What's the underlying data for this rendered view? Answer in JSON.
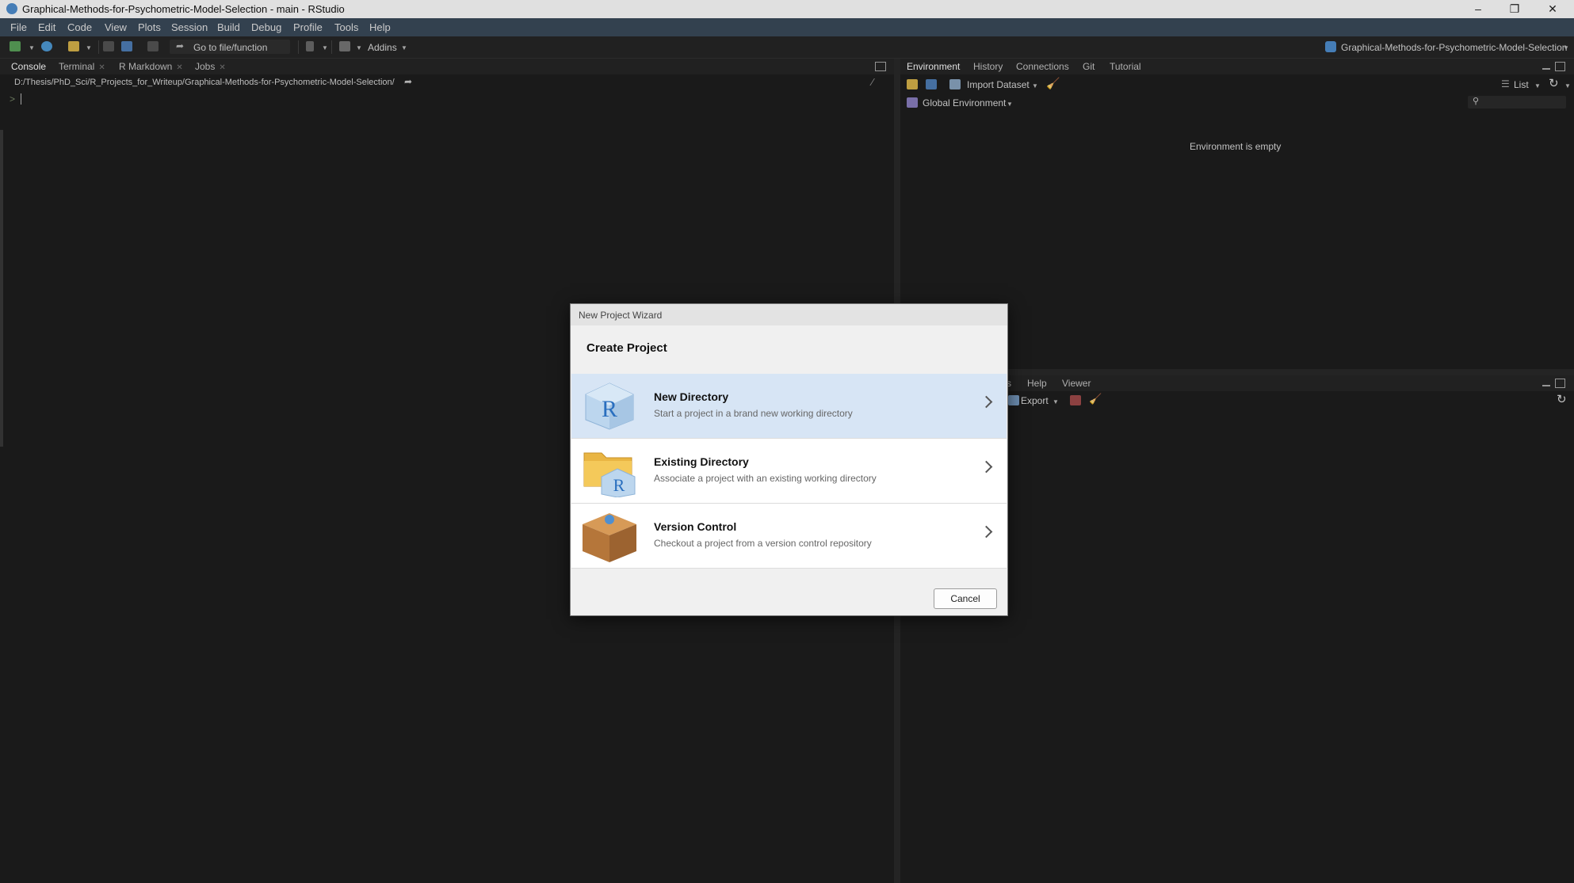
{
  "window": {
    "title": "Graphical-Methods-for-Psychometric-Model-Selection - main - RStudio",
    "controls": [
      "–",
      "❐",
      "✕"
    ]
  },
  "menu": [
    "File",
    "Edit",
    "Code",
    "View",
    "Plots",
    "Session",
    "Build",
    "Debug",
    "Profile",
    "Tools",
    "Help"
  ],
  "toolbar": {
    "goto_label": "Go to file/function",
    "addins_label": "Addins",
    "project_label": "Graphical-Methods-for-Psychometric-Model-Selection"
  },
  "console_pane": {
    "tabs": [
      "Console",
      "Terminal",
      "R Markdown",
      "Jobs"
    ],
    "path": "D:/Thesis/PhD_Sci/R_Projects_for_Writeup/Graphical-Methods-for-Psychometric-Model-Selection/",
    "prompt": ">"
  },
  "env_pane": {
    "tabs": [
      "Environment",
      "History",
      "Connections",
      "Git",
      "Tutorial"
    ],
    "import_label": "Import Dataset",
    "list_label": "List",
    "scope_label": "Global Environment",
    "empty_message": "Environment is empty"
  },
  "lower_pane": {
    "tabs": [
      "s",
      "Help",
      "Viewer"
    ],
    "export_label": "Export"
  },
  "dialog": {
    "window_title": "New Project Wizard",
    "header": "Create Project",
    "options": [
      {
        "name": "New Directory",
        "desc": "Start a project in a brand new working directory"
      },
      {
        "name": "Existing Directory",
        "desc": "Associate a project with an existing working directory"
      },
      {
        "name": "Version Control",
        "desc": "Checkout a project from a version control repository"
      }
    ],
    "cancel_label": "Cancel"
  },
  "colors": {
    "menubar": "#3b4a5b",
    "pane_bg": "#1e1e1e",
    "selected_option": "#d7e5f5",
    "r_logo_blue": "#2a6fbf",
    "box_brown": "#b5763a"
  }
}
